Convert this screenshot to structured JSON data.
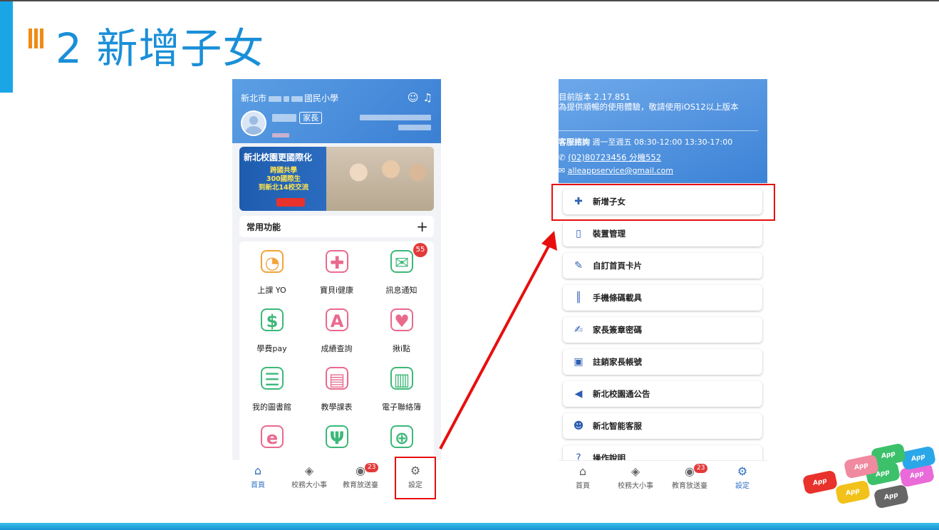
{
  "slide": {
    "number": "2",
    "title": "新增子女"
  },
  "left_phone": {
    "school": "新北市",
    "school_suffix": "國民小學",
    "role": "家長",
    "banner": {
      "title": "新北校園更國際化",
      "lines": [
        "跨國共學",
        "300國際生",
        "到新北14校交流"
      ]
    },
    "favorites": {
      "title": "常用功能",
      "add": "+"
    },
    "apps": [
      {
        "label": "上課 YO",
        "icon": "clock-person-icon",
        "color": "#f2a33a"
      },
      {
        "label": "寶貝i健康",
        "icon": "medical-kit-icon",
        "color": "#e96a8d"
      },
      {
        "label": "訊息通知",
        "icon": "mail-wifi-icon",
        "color": "#3cb878",
        "badge": "55"
      },
      {
        "label": "學費pay",
        "icon": "phone-pay-icon",
        "color": "#3cb878"
      },
      {
        "label": "成績查詢",
        "icon": "grade-paper-icon",
        "color": "#e96a8d"
      },
      {
        "label": "揪i點",
        "icon": "people-heart-icon",
        "color": "#e96a8d"
      },
      {
        "label": "我的圖書館",
        "icon": "bookshelf-icon",
        "color": "#3cb878"
      },
      {
        "label": "教學課表",
        "icon": "monitor-schedule-icon",
        "color": "#e96a8d"
      },
      {
        "label": "電子聯絡簿",
        "icon": "contact-book-icon",
        "color": "#3cb878"
      },
      {
        "label": "",
        "icon": "cloud-e-icon",
        "color": "#e96a8d"
      },
      {
        "label": "",
        "icon": "fork-spoon-icon",
        "color": "#3cb878"
      },
      {
        "label": "",
        "icon": "globe-icon",
        "color": "#3cb878"
      }
    ],
    "tabs": [
      {
        "label": "首頁",
        "icon": "home-icon",
        "active": true
      },
      {
        "label": "校務大小事",
        "icon": "box-icon"
      },
      {
        "label": "教育放送臺",
        "icon": "broadcast-icon",
        "badge": "23"
      },
      {
        "label": "設定",
        "icon": "gear-icon"
      }
    ]
  },
  "right_phone": {
    "version_line1": "目前版本 2.17.851",
    "version_line2": "為提供順暢的使用體驗，敬請使用iOS12以上版本",
    "service_label": "客服諮詢",
    "service_hours": "週一至週五 08:30-12:00 13:30-17:00",
    "phone": "(02)80723456 分機552",
    "email": "alleappservice@gmail.com",
    "menu": [
      {
        "label": "新增子女",
        "icon": "add-user-icon"
      },
      {
        "label": "裝置管理",
        "icon": "device-icon"
      },
      {
        "label": "自訂首頁卡片",
        "icon": "pencil-icon"
      },
      {
        "label": "手機條碼載具",
        "icon": "barcode-icon"
      },
      {
        "label": "家長簽章密碼",
        "icon": "signature-lock-icon"
      },
      {
        "label": "註銷家長帳號",
        "icon": "trash-icon"
      },
      {
        "label": "新北校園通公告",
        "icon": "megaphone-icon"
      },
      {
        "label": "新北智能客服",
        "icon": "robot-icon"
      },
      {
        "label": "操作說明",
        "icon": "help-icon"
      }
    ],
    "tabs": [
      {
        "label": "首頁",
        "icon": "home-icon"
      },
      {
        "label": "校務大小事",
        "icon": "box-icon"
      },
      {
        "label": "教育放送臺",
        "icon": "broadcast-icon",
        "badge": "23"
      },
      {
        "label": "設定",
        "icon": "gear-icon",
        "active": true
      }
    ]
  },
  "decor": {
    "key_label": "App",
    "colors": {
      "accent": "#1aa5e6",
      "highlight": "#e80e0e",
      "title": "#1a8fd8",
      "mark": "#f08a14"
    }
  }
}
